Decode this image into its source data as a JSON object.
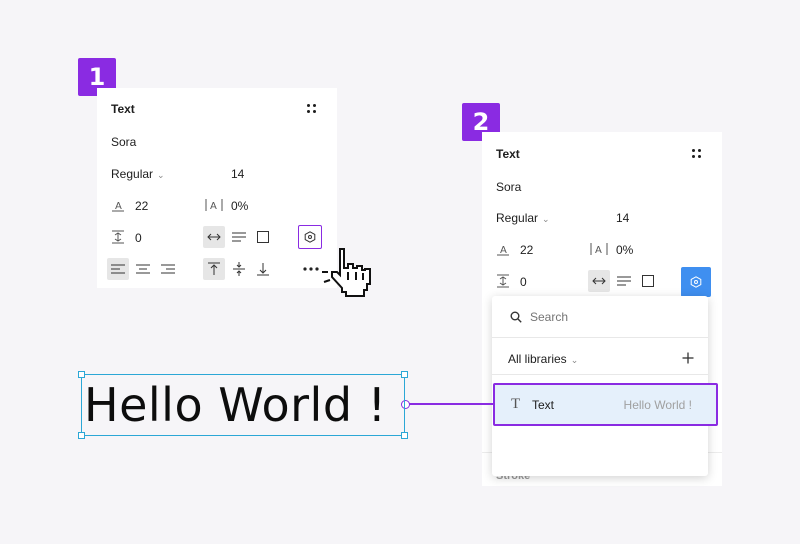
{
  "step1": {
    "number": "1"
  },
  "step2": {
    "number": "2"
  },
  "panel1": {
    "title": "Text",
    "font_family": "Sora",
    "font_weight": "Regular",
    "font_size": "14",
    "line_height": "22",
    "letter_spacing": "0%",
    "paragraph_spacing": "0"
  },
  "panel2": {
    "title": "Text",
    "font_family": "Sora",
    "font_weight": "Regular",
    "font_size": "14",
    "line_height": "22",
    "letter_spacing": "0%",
    "paragraph_spacing": "0"
  },
  "dropdown": {
    "search_placeholder": "Search",
    "library_filter": "All libraries",
    "style_item": {
      "name": "Text",
      "preview": "Hello World !"
    },
    "behind_label": "Stroke"
  },
  "canvas": {
    "text": "Hello World !"
  },
  "colors": {
    "accent": "#8a2be2",
    "selection": "#2ba7d6",
    "primary_button": "#3f8ff0"
  }
}
